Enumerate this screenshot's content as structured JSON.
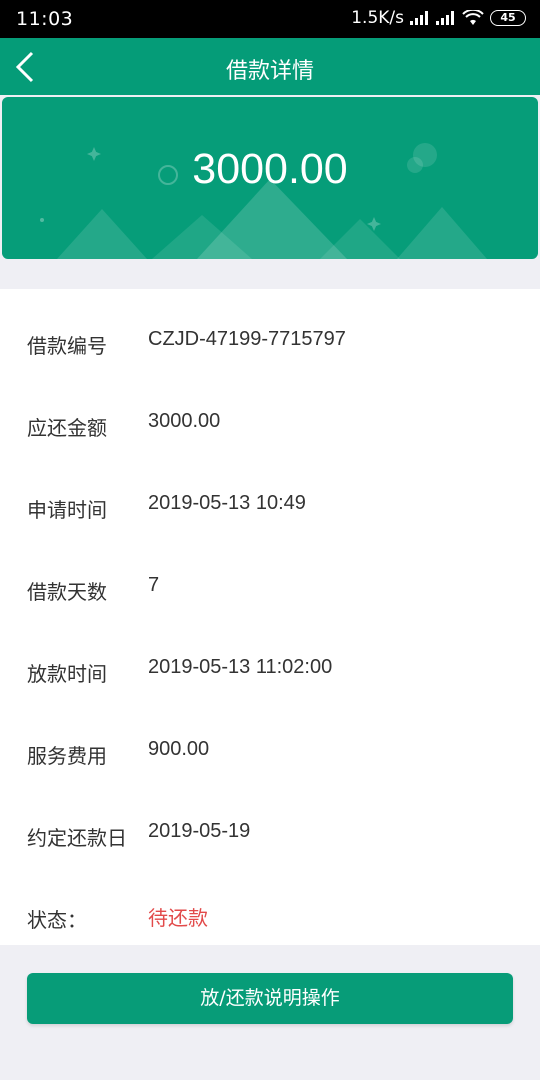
{
  "status_bar": {
    "time": "11:03",
    "speed": "1.5K/s",
    "battery": "45"
  },
  "navbar": {
    "title": "借款详情",
    "back_icon": "chevron-left-icon"
  },
  "banner": {
    "amount": "3000.00"
  },
  "details": {
    "rows": [
      {
        "label": "借款编号",
        "value": "CZJD-47199-7715797"
      },
      {
        "label": "应还金额",
        "value": "3000.00"
      },
      {
        "label": "申请时间",
        "value": "2019-05-13 10:49"
      },
      {
        "label": "借款天数",
        "value": "7"
      },
      {
        "label": "放款时间",
        "value": "2019-05-13 11:02:00"
      },
      {
        "label": "服务费用",
        "value": "900.00"
      },
      {
        "label": "约定还款日",
        "value": "2019-05-19"
      },
      {
        "label": "状态：",
        "value": "待还款"
      }
    ]
  },
  "action": {
    "label": "放/还款说明操作"
  },
  "colors": {
    "primary": "#059c78",
    "status_red": "#e24a4a",
    "background": "#efeff4"
  }
}
